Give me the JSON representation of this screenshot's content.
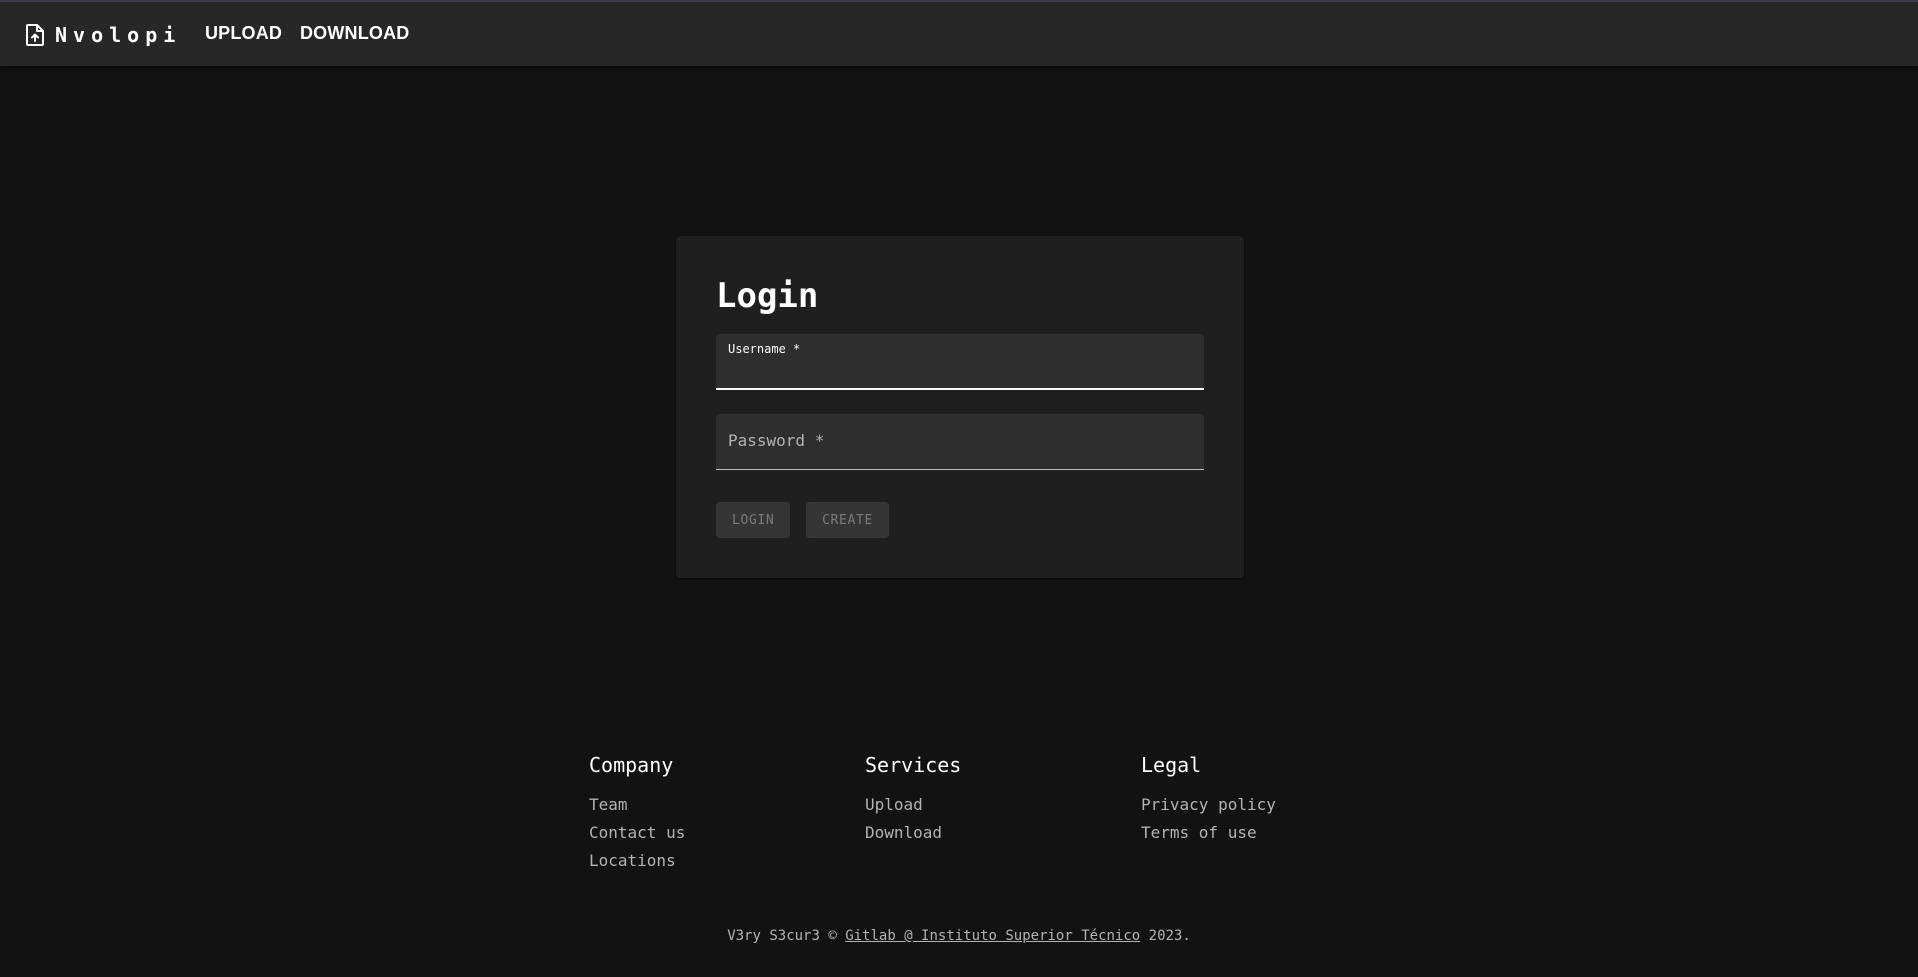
{
  "header": {
    "brand": "Nvolopi",
    "brand_icon": "file-upload-icon",
    "nav": {
      "upload": "UPLOAD",
      "download": "DOWNLOAD"
    }
  },
  "login": {
    "title": "Login",
    "username": {
      "label": "Username *",
      "value": ""
    },
    "password": {
      "label": "Password *",
      "value": ""
    },
    "buttons": {
      "login": "LOGIN",
      "create": "CREATE"
    }
  },
  "footer": {
    "columns": [
      {
        "heading": "Company",
        "links": [
          "Team",
          "Contact us",
          "Locations"
        ]
      },
      {
        "heading": "Services",
        "links": [
          "Upload",
          "Download"
        ]
      },
      {
        "heading": "Legal",
        "links": [
          "Privacy policy",
          "Terms of use"
        ]
      }
    ],
    "copyright": {
      "prefix": "V3ry S3cur3 © ",
      "link": "Gitlab @ Instituto Superior Técnico",
      "suffix": " 2023."
    }
  },
  "colors": {
    "background": "#121212",
    "appbar": "#272727",
    "card": "#1f1f1f",
    "field": "#2e2e2e",
    "button_disabled": "#353535"
  }
}
